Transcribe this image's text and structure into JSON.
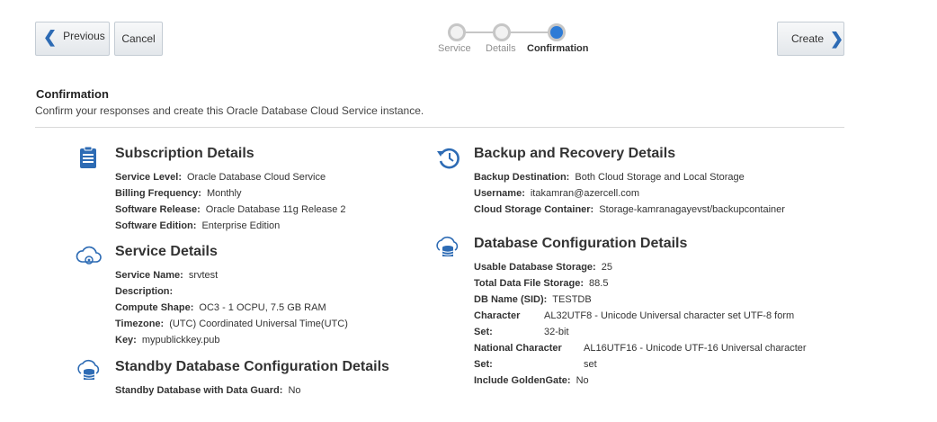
{
  "toolbar": {
    "previous_label": "Previous",
    "cancel_label": "Cancel",
    "create_label": "Create"
  },
  "train": {
    "stops": [
      "Service",
      "Details",
      "Confirmation"
    ],
    "current_index": 2
  },
  "header": {
    "title": "Confirmation",
    "subtitle": "Confirm your responses and create this Oracle Database Cloud Service instance."
  },
  "subscription": {
    "title": "Subscription Details",
    "icon": "clipboard-icon",
    "rows": [
      {
        "k": "Service Level:",
        "v": "Oracle Database Cloud Service"
      },
      {
        "k": "Billing Frequency:",
        "v": "Monthly"
      },
      {
        "k": "Software Release:",
        "v": "Oracle Database 11g Release 2"
      },
      {
        "k": "Software Edition:",
        "v": "Enterprise Edition"
      }
    ]
  },
  "service": {
    "title": "Service Details",
    "icon": "cloud-gear-icon",
    "rows": [
      {
        "k": "Service Name:",
        "v": "srvtest"
      },
      {
        "k": "Description:",
        "v": ""
      },
      {
        "k": "Compute Shape:",
        "v": "OC3 - 1 OCPU, 7.5 GB RAM"
      },
      {
        "k": "Timezone:",
        "v": "(UTC) Coordinated Universal Time(UTC)"
      },
      {
        "k": "Key:",
        "v": "mypublickkey.pub"
      }
    ]
  },
  "standby": {
    "title": "Standby Database Configuration Details",
    "icon": "cloud-database-icon",
    "rows": [
      {
        "k": "Standby Database with Data Guard:",
        "v": "No"
      }
    ]
  },
  "backup": {
    "title": "Backup and Recovery Details",
    "icon": "backup-clock-icon",
    "rows": [
      {
        "k": "Backup Destination:",
        "v": "Both Cloud Storage and Local Storage"
      },
      {
        "k": "Username:",
        "v": "itakamran@azercell.com"
      },
      {
        "k": "Cloud Storage Container:",
        "v": "Storage-kamranagayevst/backupcontainer"
      }
    ]
  },
  "dbconfig": {
    "title": "Database Configuration Details",
    "icon": "cloud-database-icon",
    "rows": [
      {
        "k": "Usable Database Storage:",
        "v": "25"
      },
      {
        "k": "Total Data File Storage:",
        "v": "88.5"
      },
      {
        "k": "DB Name (SID):",
        "v": "TESTDB"
      },
      {
        "k": "Character",
        "v": "AL32UTF8 - Unicode Universal character set UTF-8 form"
      },
      {
        "k": "Set:",
        "v": "32-bit"
      },
      {
        "k": "National Character",
        "v": "AL16UTF16 - Unicode UTF-16 Universal character"
      },
      {
        "k": "Set:",
        "v": "set"
      },
      {
        "k": "Include GoldenGate:",
        "v": "No"
      }
    ]
  },
  "colors": {
    "accent": "#2d7bd6",
    "icon_blue": "#2d6bb4"
  }
}
